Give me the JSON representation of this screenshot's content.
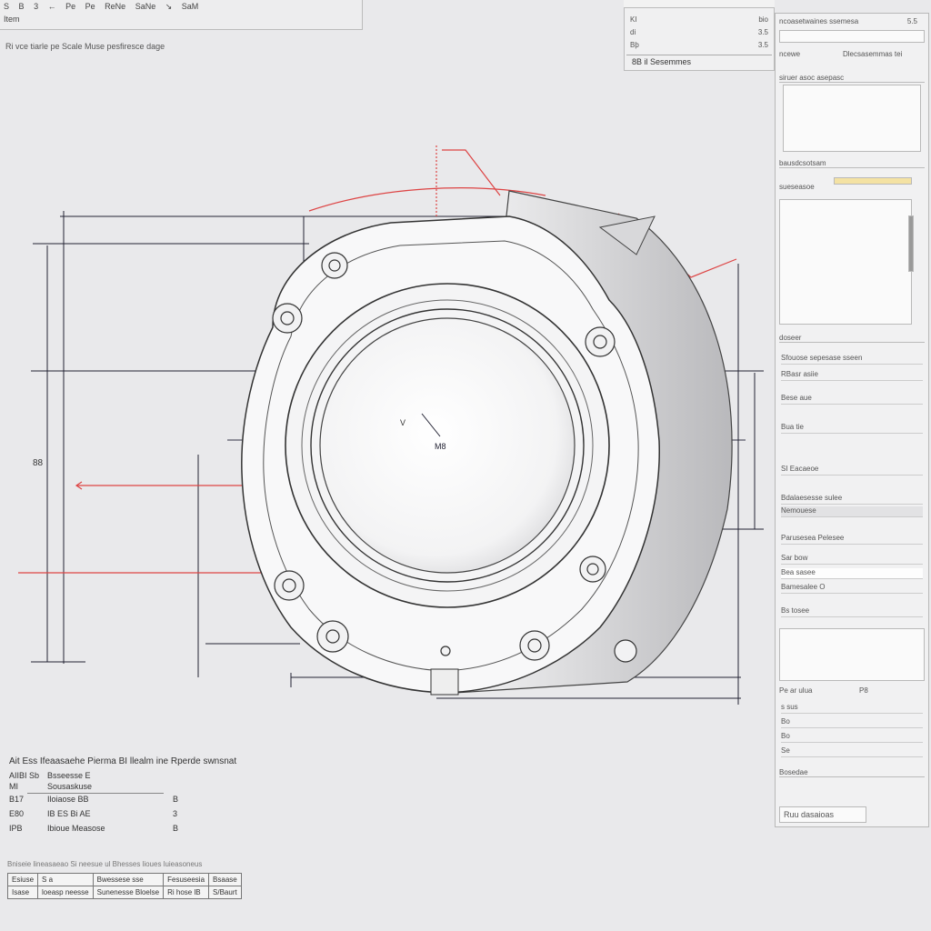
{
  "toolbar": {
    "buttons": [
      "S",
      "B",
      "3",
      "←",
      "Pe",
      "Pe",
      "ReNe",
      "SaNe",
      "↘",
      "SaM"
    ],
    "tab_label": "Item",
    "caption": "Ri vce tiarle pe  Scale Muse pesfiresce dage"
  },
  "mini_panel": {
    "rows": [
      {
        "label": "KI",
        "value": "bio"
      },
      {
        "label": "di",
        "value": "3.5"
      },
      {
        "label": "Bþ",
        "value": "3.5"
      }
    ],
    "footer": "8B il Sesemmes"
  },
  "properties": {
    "header": "ncoasetwaines  ssemesa",
    "header_value": "5.5",
    "section1_label": "ncewe",
    "section1_value": "Dlecsasemmas tei",
    "section1_note": "siruer  asoc  asepasc",
    "section2_title": "bausdcsotsam",
    "section2_sub": "sueseasoe",
    "section3_label": "doseer",
    "fields": [
      "Sfouose sepesase  sseen",
      "RBasr asiie",
      "Bese aue",
      "Bua tie",
      "SI  Eacaeoe",
      "Bdalaesesse sulee",
      "Nemouese",
      "Parusesea Pelesee",
      "Sar bow",
      "Bea  sasee",
      "Bamesalee  O",
      "Bs tosee"
    ],
    "list_header": "Pe  ar ulua",
    "list_value": "P8",
    "list_items": [
      "s sus",
      "Bo",
      "Bo",
      "Se"
    ],
    "footer_label": "Bosedae",
    "button": "Ruu dasaioas"
  },
  "drawing": {
    "dim_label_a": "88",
    "center_label": "M8",
    "marker": "V"
  },
  "note": {
    "heading": "Ait  Ess   Ifeaasaehe  Pierma BI  llealm ine  Rperde swnsnat",
    "rows": [
      {
        "c1": "AIIBI Sb",
        "c2": "Bsseesse  E",
        "c3": ""
      },
      {
        "c1": "MI",
        "c2": "Sousaskuse",
        "c3": ""
      },
      {
        "c1": "B17",
        "c2": "Iloiaose BB",
        "c3": "B"
      },
      {
        "c1": "E80",
        "c2": "IB ES  Bi AE",
        "c3": "3"
      },
      {
        "c1": "IPB",
        "c2": "Ibioue  Measose",
        "c3": "B"
      }
    ]
  },
  "title_block": {
    "caption": "Bniseie  lineasaeao  Si neesue  ul  Bhesses  lioues  luieasoneus",
    "rows": [
      [
        "Esiuse",
        "S  a",
        "Bwessese  sse",
        "Fesuseesia",
        "Bsaase"
      ],
      [
        "Isase",
        "loeasp  neesse",
        "Sunenesse  Bloelse",
        "Ri  hose  lB",
        "S/Baurt"
      ]
    ]
  }
}
